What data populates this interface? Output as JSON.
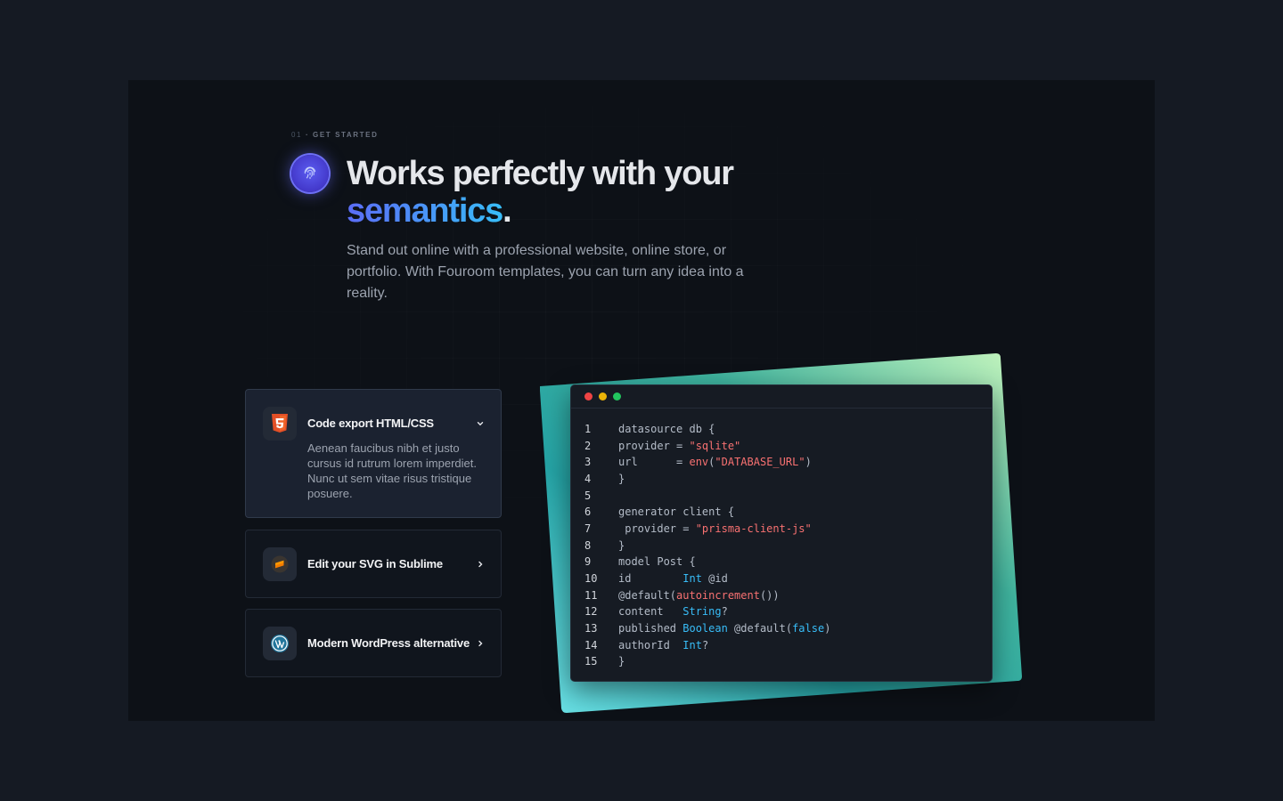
{
  "section": {
    "eyebrow_num": "01",
    "eyebrow_label": "· GET STARTED",
    "headline_main": "Works perfectly with your",
    "headline_accent": "semantics",
    "headline_end": ".",
    "lead": "Stand out online with a professional website, online store, or portfolio. With Fouroom templates, you can turn any idea into a reality."
  },
  "features": [
    {
      "title": "Code export HTML/CSS",
      "description": "Aenean faucibus nibh et justo cursus id rutrum lorem imperdiet. Nunc ut sem vitae risus tristique posuere.",
      "icon": "html5-icon",
      "expanded": true
    },
    {
      "title": "Edit your SVG in Sublime",
      "icon": "sublime-icon",
      "expanded": false
    },
    {
      "title": "Modern WordPress alternative",
      "icon": "wordpress-icon",
      "expanded": false
    }
  ],
  "editor": {
    "lines": [
      {
        "n": "1",
        "code": "datasource db {"
      },
      {
        "n": "2",
        "code": "provider = \"sqlite\""
      },
      {
        "n": "3",
        "code": "url      = env(\"DATABASE_URL\")"
      },
      {
        "n": "4",
        "code": "}"
      },
      {
        "n": "5",
        "code": ""
      },
      {
        "n": "6",
        "code": "generator client {"
      },
      {
        "n": "7",
        "code": " provider = \"prisma-client-js\""
      },
      {
        "n": "8",
        "code": "}"
      },
      {
        "n": "9",
        "code": "model Post {"
      },
      {
        "n": "10",
        "code": "id        Int @id"
      },
      {
        "n": "11",
        "code": "@default(autoincrement())"
      },
      {
        "n": "12",
        "code": "content   String?"
      },
      {
        "n": "13",
        "code": "published Boolean @default(false)"
      },
      {
        "n": "14",
        "code": "authorId  Int?"
      },
      {
        "n": "15",
        "code": "}"
      }
    ]
  },
  "colors": {
    "accent": "#5b6cf6",
    "slab_start": "#1a9c9a",
    "slab_end": "#b9f2c2"
  }
}
